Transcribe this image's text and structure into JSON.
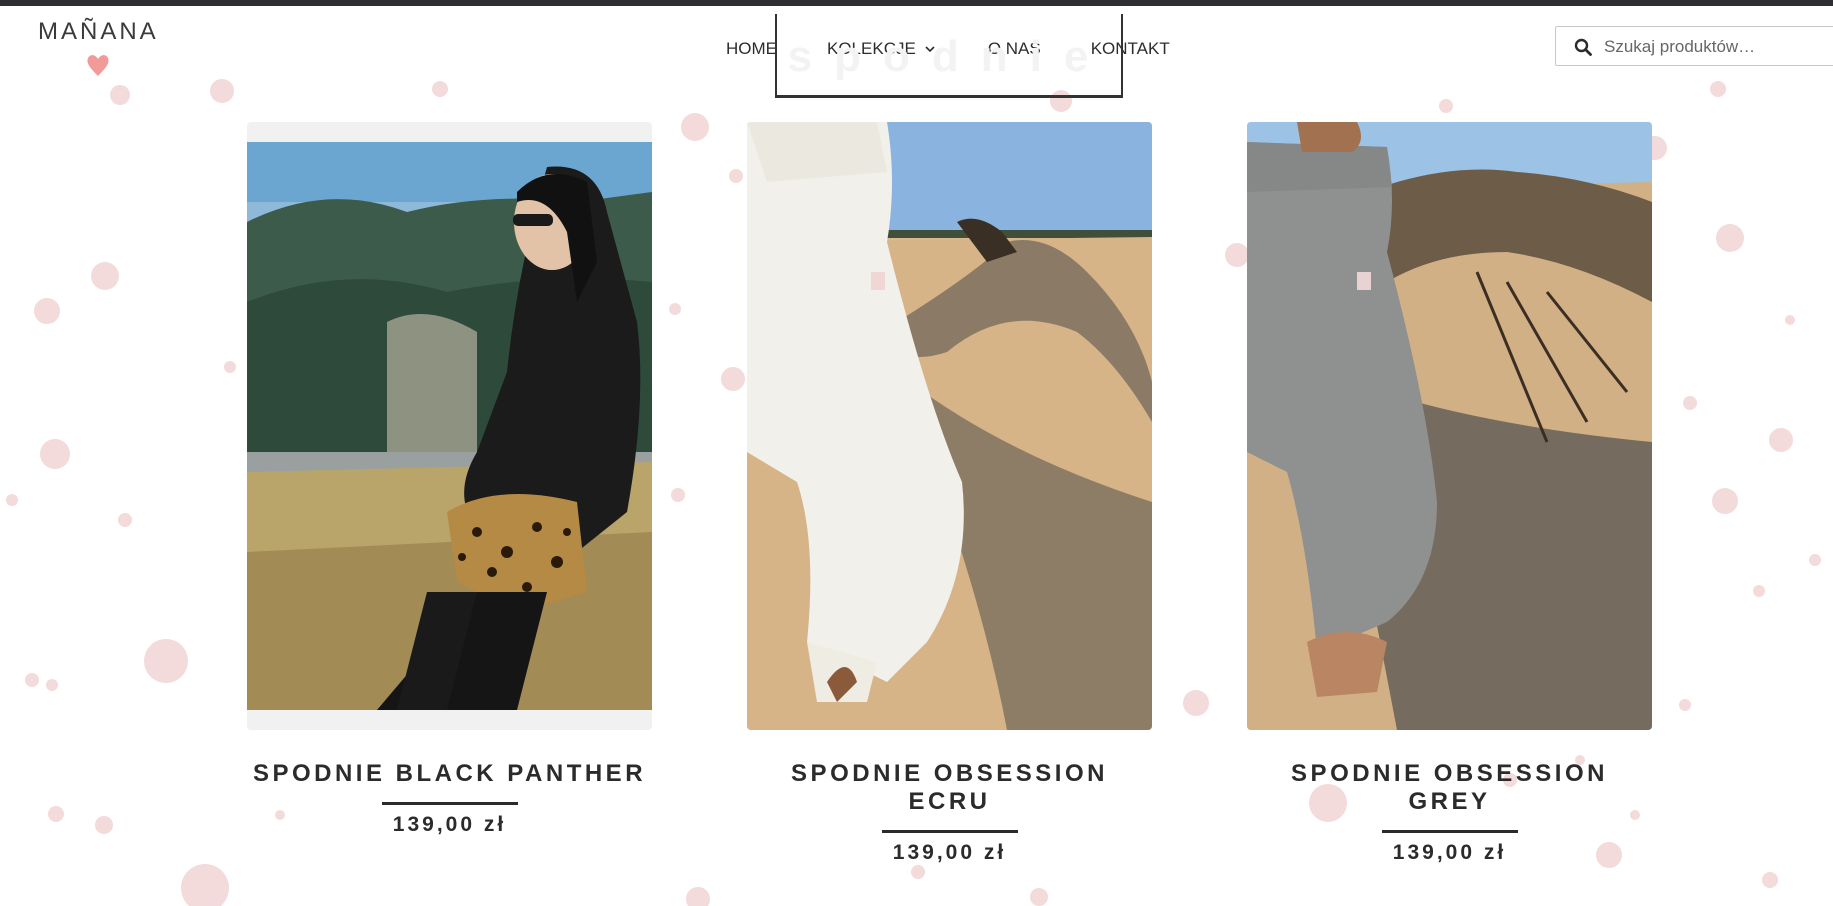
{
  "brand": {
    "logo_text": "MAÑANA"
  },
  "nav": {
    "items": [
      {
        "label": "HOME"
      },
      {
        "label": "KOLEKCJE"
      },
      {
        "label": "O NAS"
      },
      {
        "label": "KONTAKT"
      }
    ]
  },
  "page": {
    "heading": "spodnie"
  },
  "search": {
    "placeholder": "Szukaj produktów…"
  },
  "products": [
    {
      "name": "SPODNIE BLACK PANTHER",
      "price": "139,00 zł"
    },
    {
      "name": "SPODNIE OBSESSION ECRU",
      "price": "139,00 zł"
    },
    {
      "name": "SPODNIE OBSESSION GREY",
      "price": "139,00 zł"
    }
  ],
  "colors": {
    "dots": "#f2d9da",
    "heart": "#f19a9a",
    "text": "#2b2b2b"
  }
}
